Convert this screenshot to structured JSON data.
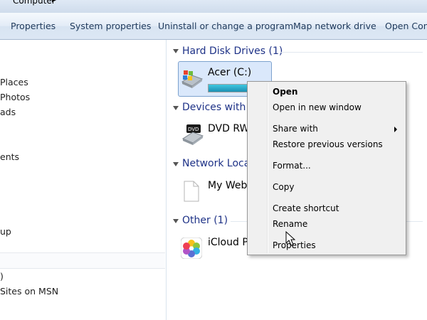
{
  "window": {
    "breadcrumb": "Computer"
  },
  "toolbar": {
    "properties": "Properties",
    "system_properties": "System properties",
    "uninstall": "Uninstall or change a program",
    "map_network": "Map network drive",
    "open_control": "Open Cont"
  },
  "nav": {
    "items": [
      "Places",
      "Photos",
      "ads",
      "ents",
      "up",
      ")",
      "Sites on MSN"
    ]
  },
  "groups": {
    "hard_disk": "Hard Disk Drives (1)",
    "devices": "Devices with R",
    "network": "Network Loca",
    "other": "Other (1)"
  },
  "items": {
    "drive_c": {
      "label": "Acer (C:)",
      "usage_fraction": 0.82
    },
    "dvd": {
      "label": "DVD RW"
    },
    "my_web": {
      "label": "My Web"
    },
    "icloud": {
      "label": "iCloud P"
    }
  },
  "context_menu": {
    "open": "Open",
    "open_new_window": "Open in new window",
    "share_with": "Share with",
    "restore": "Restore previous versions",
    "format": "Format...",
    "copy": "Copy",
    "create_shortcut": "Create shortcut",
    "rename": "Rename",
    "properties": "Properties"
  },
  "colors": {
    "group_heading": "#1e3287",
    "toolbar_text": "#1e395b",
    "selection": "#dae8fb",
    "menu_bg": "#f0f0f0"
  }
}
